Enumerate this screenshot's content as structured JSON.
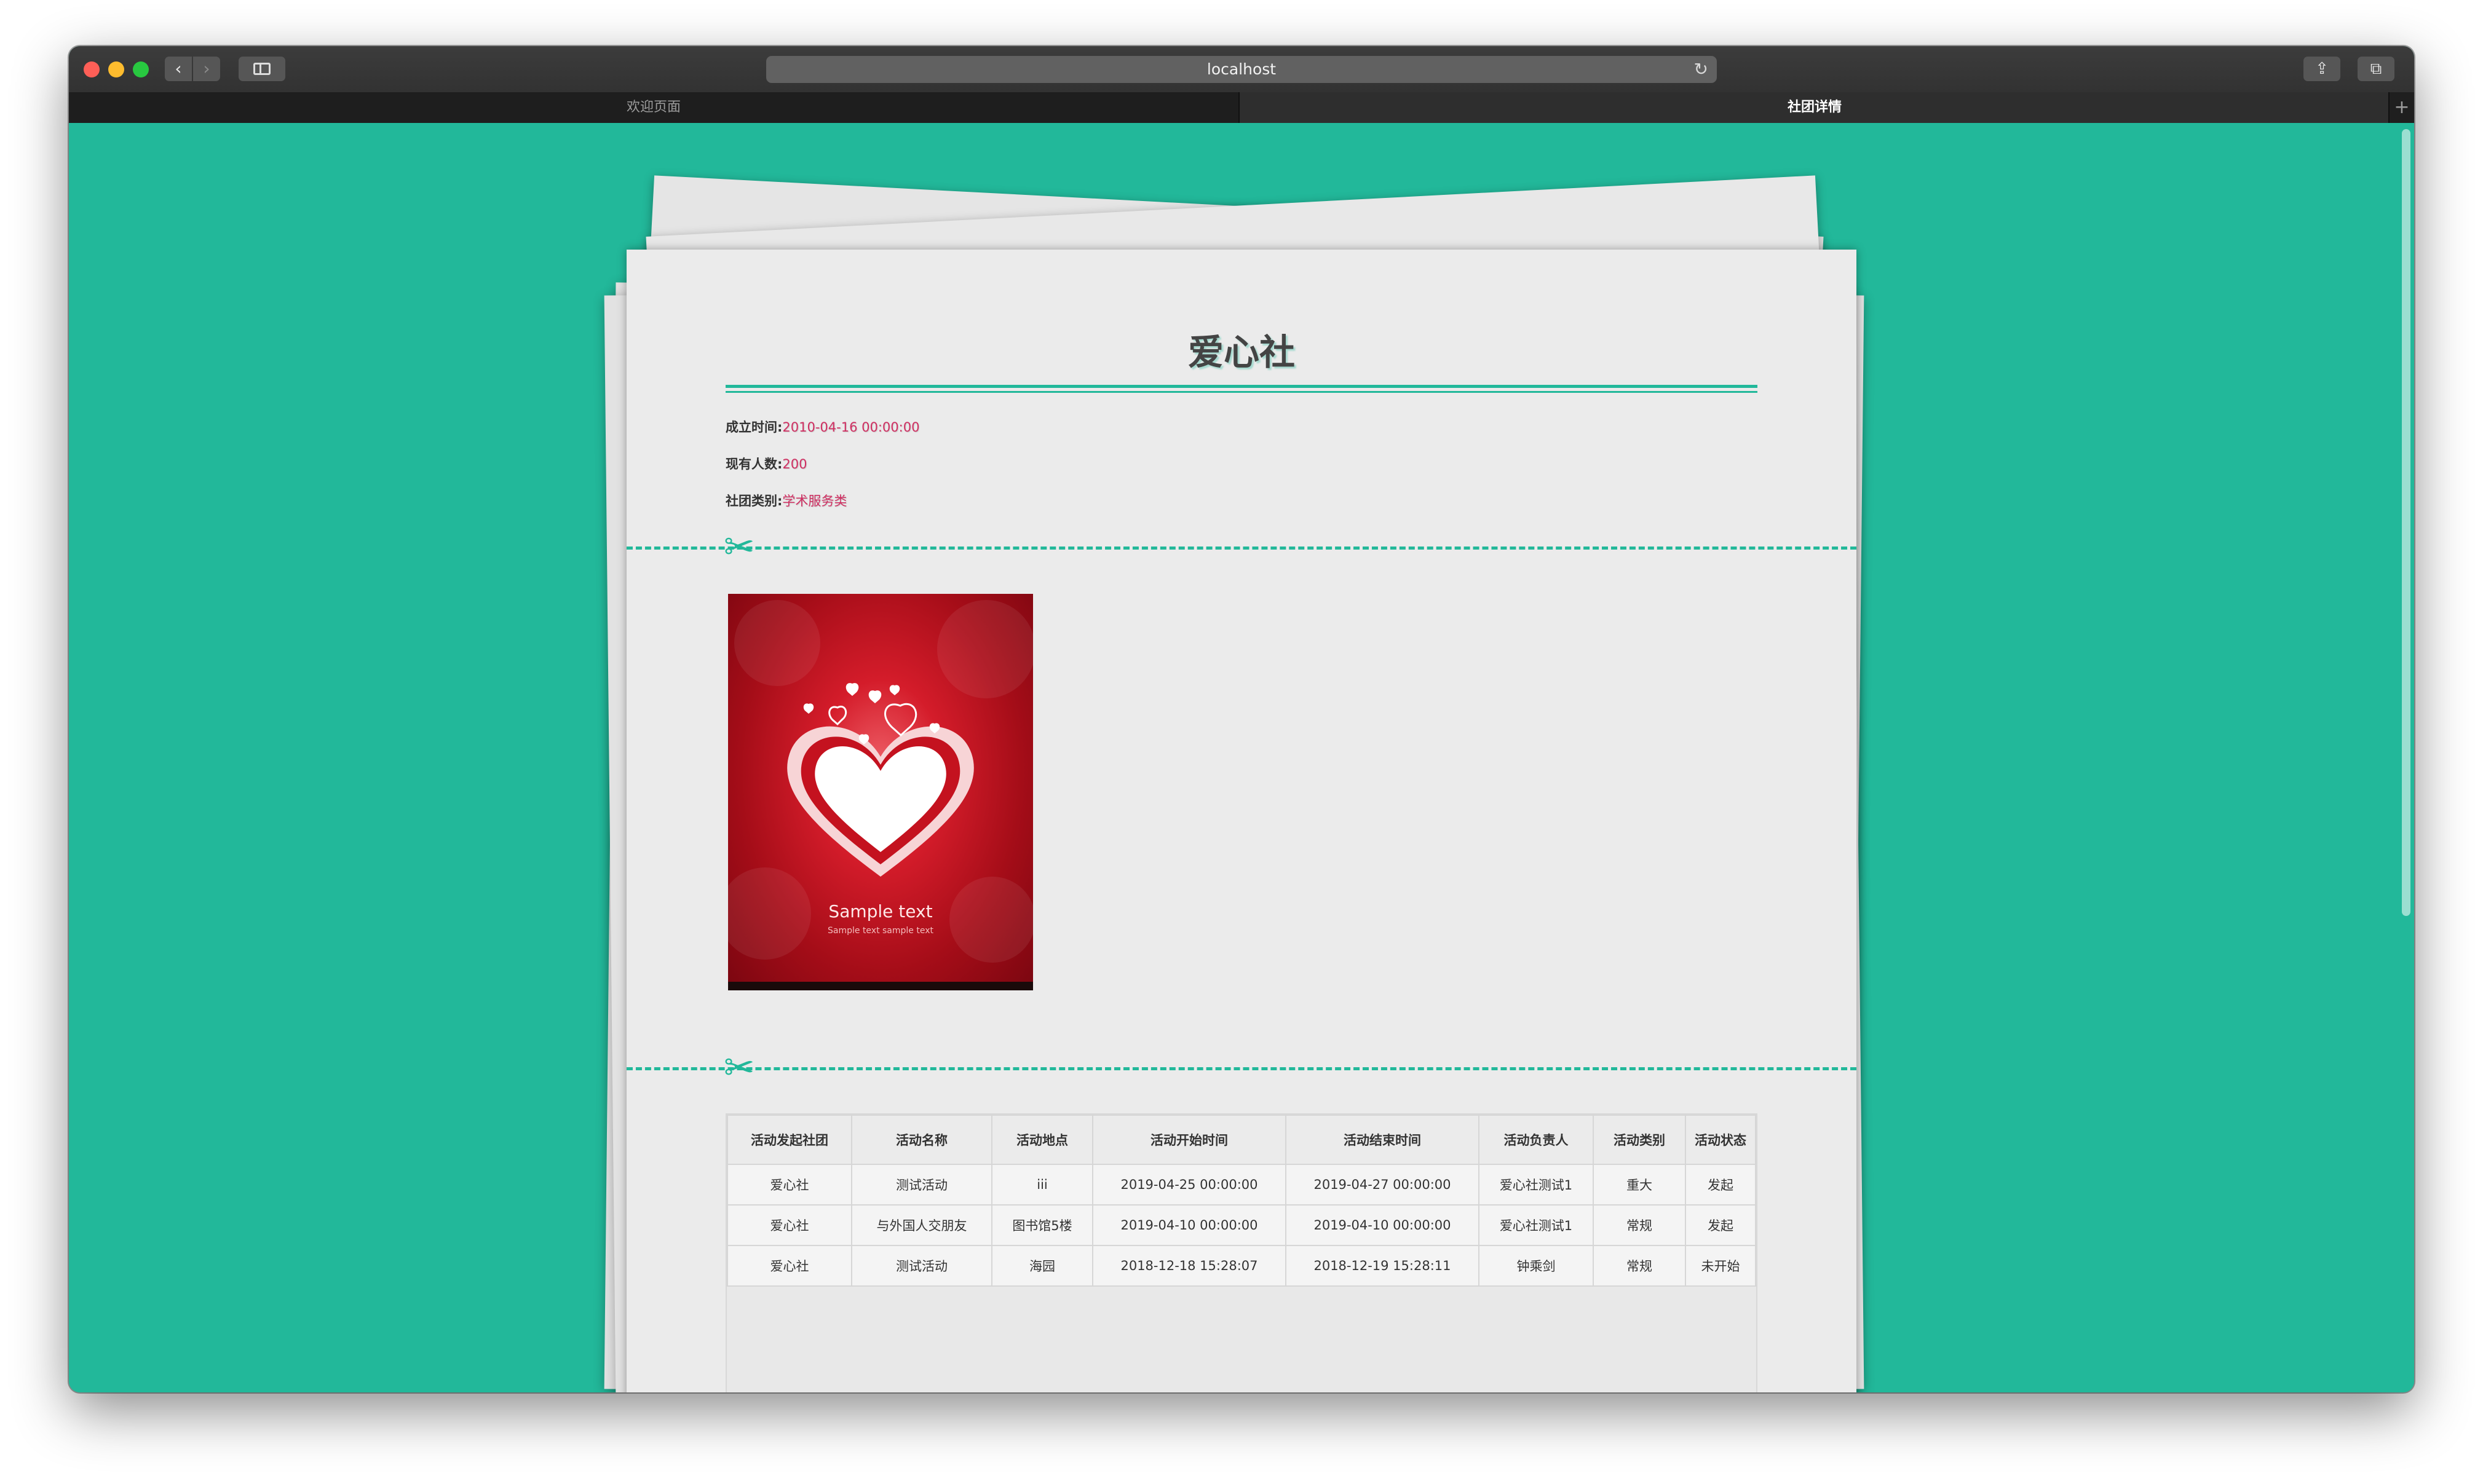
{
  "browser": {
    "url": "localhost",
    "tabs": [
      {
        "label": "欢迎页面",
        "active": false
      },
      {
        "label": "社团详情",
        "active": true
      }
    ]
  },
  "club": {
    "name": "爱心社",
    "founded_label": "成立时间:",
    "founded_value": "2010-04-16 00:00:00",
    "members_label": "现有人数:",
    "members_value": "200",
    "category_label": "社团类别:",
    "category_value": "学术服务类"
  },
  "poster": {
    "caption": "Sample text",
    "subcaption": "Sample text sample text"
  },
  "activities": {
    "headers": [
      "活动发起社团",
      "活动名称",
      "活动地点",
      "活动开始时间",
      "活动结束时间",
      "活动负责人",
      "活动类别",
      "活动状态"
    ],
    "rows": [
      [
        "爱心社",
        "测试活动",
        "iii",
        "2019-04-25 00:00:00",
        "2019-04-27 00:00:00",
        "爱心社测试1",
        "重大",
        "发起"
      ],
      [
        "爱心社",
        "与外国人交朋友",
        "图书馆5楼",
        "2019-04-10 00:00:00",
        "2019-04-10 00:00:00",
        "爱心社测试1",
        "常规",
        "发起"
      ],
      [
        "爱心社",
        "测试活动",
        "海园",
        "2018-12-18 15:28:07",
        "2018-12-19 15:28:11",
        "钟乘剑",
        "常规",
        "未开始"
      ]
    ]
  },
  "colors": {
    "accent": "#22b89a",
    "value_text": "#d02f62"
  },
  "icons": [
    "back-icon",
    "forward-icon",
    "sidebar-icon",
    "reload-icon",
    "share-icon",
    "tabs-icon",
    "new-tab-icon",
    "scissors-icon"
  ]
}
